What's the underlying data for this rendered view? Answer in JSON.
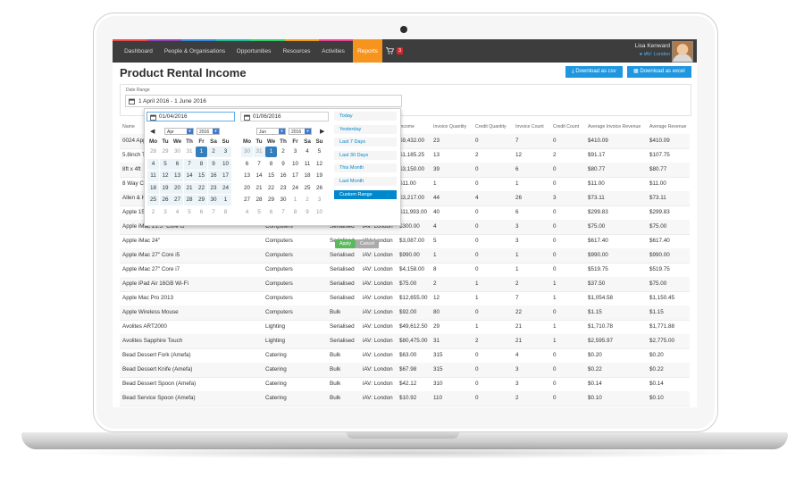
{
  "nav": {
    "items": [
      "Dashboard",
      "People & Organisations",
      "Opportunities",
      "Resources",
      "Activities",
      "Reports"
    ],
    "active": "Reports",
    "cart_count": "3",
    "brand_colors": [
      "#e8484a",
      "#8e44ad",
      "#3a87d6",
      "#1abc9c",
      "#2ecc71",
      "#f39c12",
      "#e84393"
    ]
  },
  "user": {
    "name": "Lisa Kenward",
    "location": "iAV: London"
  },
  "page": {
    "title": "Product Rental Income"
  },
  "buttons": {
    "csv": "Download as csv",
    "excel": "Download as excel"
  },
  "filter": {
    "label": "Date Range",
    "value": "1 April 2016 - 1 June 2016"
  },
  "picker": {
    "start_input": "01/04/2016",
    "end_input": "01/06/2016",
    "left": {
      "month": "Apr",
      "year": "2016"
    },
    "right": {
      "month": "Jun",
      "year": "2016"
    },
    "weekdays": [
      "Mo",
      "Tu",
      "We",
      "Th",
      "Fr",
      "Sa",
      "Su"
    ],
    "left_days": [
      [
        "28",
        "29",
        "30",
        "31",
        "1",
        "2",
        "3"
      ],
      [
        "4",
        "5",
        "6",
        "7",
        "8",
        "9",
        "10"
      ],
      [
        "11",
        "12",
        "13",
        "14",
        "15",
        "16",
        "17"
      ],
      [
        "18",
        "19",
        "20",
        "21",
        "22",
        "23",
        "24"
      ],
      [
        "25",
        "26",
        "27",
        "28",
        "29",
        "30",
        "1"
      ],
      [
        "2",
        "3",
        "4",
        "5",
        "6",
        "7",
        "8"
      ]
    ],
    "right_days": [
      [
        "30",
        "31",
        "1",
        "2",
        "3",
        "4",
        "5"
      ],
      [
        "6",
        "7",
        "8",
        "9",
        "10",
        "11",
        "12"
      ],
      [
        "13",
        "14",
        "15",
        "16",
        "17",
        "18",
        "19"
      ],
      [
        "20",
        "21",
        "22",
        "23",
        "24",
        "25",
        "26"
      ],
      [
        "27",
        "28",
        "29",
        "30",
        "1",
        "2",
        "3"
      ],
      [
        "4",
        "5",
        "6",
        "7",
        "8",
        "9",
        "10"
      ]
    ],
    "ranges": [
      "Today",
      "Yesterday",
      "Last 7 Days",
      "Last 30 Days",
      "This Month",
      "Last Month",
      "Custom Range"
    ],
    "active_range": "Custom Range",
    "apply": "Apply",
    "cancel": "Cancel"
  },
  "table": {
    "headers": [
      "Name",
      "",
      "",
      "",
      "Income",
      "Invoice Quantity",
      "Credit Quantity",
      "Invoice Count",
      "Credit Count",
      "Average Invoice Revenue",
      "Average Revenue"
    ],
    "rows": [
      [
        "0024 Apple",
        "",
        "",
        "",
        "$9,432.00",
        "23",
        "0",
        "7",
        "0",
        "$410.09",
        "$410.09"
      ],
      [
        "5.8inch T",
        "",
        "",
        "",
        "$1,185.25",
        "13",
        "2",
        "12",
        "2",
        "$91.17",
        "$107.75"
      ],
      [
        "8ft x 4ft",
        "",
        "",
        "",
        "$3,150.00",
        "39",
        "0",
        "6",
        "0",
        "$80.77",
        "$80.77"
      ],
      [
        "8 Way CA",
        "",
        "",
        "",
        "$11.00",
        "1",
        "0",
        "1",
        "0",
        "$11.00",
        "$11.00"
      ],
      [
        "Allen & H",
        "",
        "",
        "",
        "$3,217.00",
        "44",
        "4",
        "26",
        "3",
        "$73.11",
        "$73.11"
      ],
      [
        "Apple 15",
        "",
        "",
        "",
        "$11,993.00",
        "40",
        "0",
        "6",
        "0",
        "$299.83",
        "$299.83"
      ],
      [
        "Apple iMac 21.5\" Core i5",
        "Computers",
        "Serialised",
        "iAV: London",
        "$300.00",
        "4",
        "0",
        "3",
        "0",
        "$75.00",
        "$75.00"
      ],
      [
        "Apple iMac 24\"",
        "Computers",
        "Serialised",
        "iAV: London",
        "$3,087.00",
        "5",
        "0",
        "3",
        "0",
        "$617.40",
        "$617.40"
      ],
      [
        "Apple iMac 27\" Core i5",
        "Computers",
        "Serialised",
        "iAV: London",
        "$990.00",
        "1",
        "0",
        "1",
        "0",
        "$990.00",
        "$990.00"
      ],
      [
        "Apple iMac 27\" Core i7",
        "Computers",
        "Serialised",
        "iAV: London",
        "$4,158.00",
        "8",
        "0",
        "1",
        "0",
        "$519.75",
        "$519.75"
      ],
      [
        "Apple iPad Air 16GB Wi-Fi",
        "Computers",
        "Serialised",
        "iAV: London",
        "$75.00",
        "2",
        "1",
        "2",
        "1",
        "$37.50",
        "$75.00"
      ],
      [
        "Apple Mac Pro 2013",
        "Computers",
        "Serialised",
        "iAV: London",
        "$12,655.00",
        "12",
        "1",
        "7",
        "1",
        "$1,054.58",
        "$1,150.45"
      ],
      [
        "Apple Wireless Mouse",
        "Computers",
        "Bulk",
        "iAV: London",
        "$92.00",
        "80",
        "0",
        "22",
        "0",
        "$1.15",
        "$1.15"
      ],
      [
        "Avolites ART2000",
        "Lighting",
        "Serialised",
        "iAV: London",
        "$49,612.50",
        "29",
        "1",
        "21",
        "1",
        "$1,710.78",
        "$1,771.88"
      ],
      [
        "Avolites Sapphire Touch",
        "Lighting",
        "Serialised",
        "iAV: London",
        "$80,475.00",
        "31",
        "2",
        "21",
        "1",
        "$2,595.97",
        "$2,775.00"
      ],
      [
        "Bead Dessert Fork (Amefa)",
        "Catering",
        "Bulk",
        "iAV: London",
        "$63.00",
        "315",
        "0",
        "4",
        "0",
        "$0.20",
        "$0.20"
      ],
      [
        "Bead Dessert Knife (Amefa)",
        "Catering",
        "Bulk",
        "iAV: London",
        "$67.98",
        "315",
        "0",
        "3",
        "0",
        "$0.22",
        "$0.22"
      ],
      [
        "Bead Dessert Spoon (Amefa)",
        "Catering",
        "Bulk",
        "iAV: London",
        "$42.12",
        "310",
        "0",
        "3",
        "0",
        "$0.14",
        "$0.14"
      ],
      [
        "Bead Service Spoon (Amefa)",
        "Catering",
        "Bulk",
        "iAV: London",
        "$10.92",
        "110",
        "0",
        "2",
        "0",
        "$0.10",
        "$0.10"
      ]
    ]
  }
}
